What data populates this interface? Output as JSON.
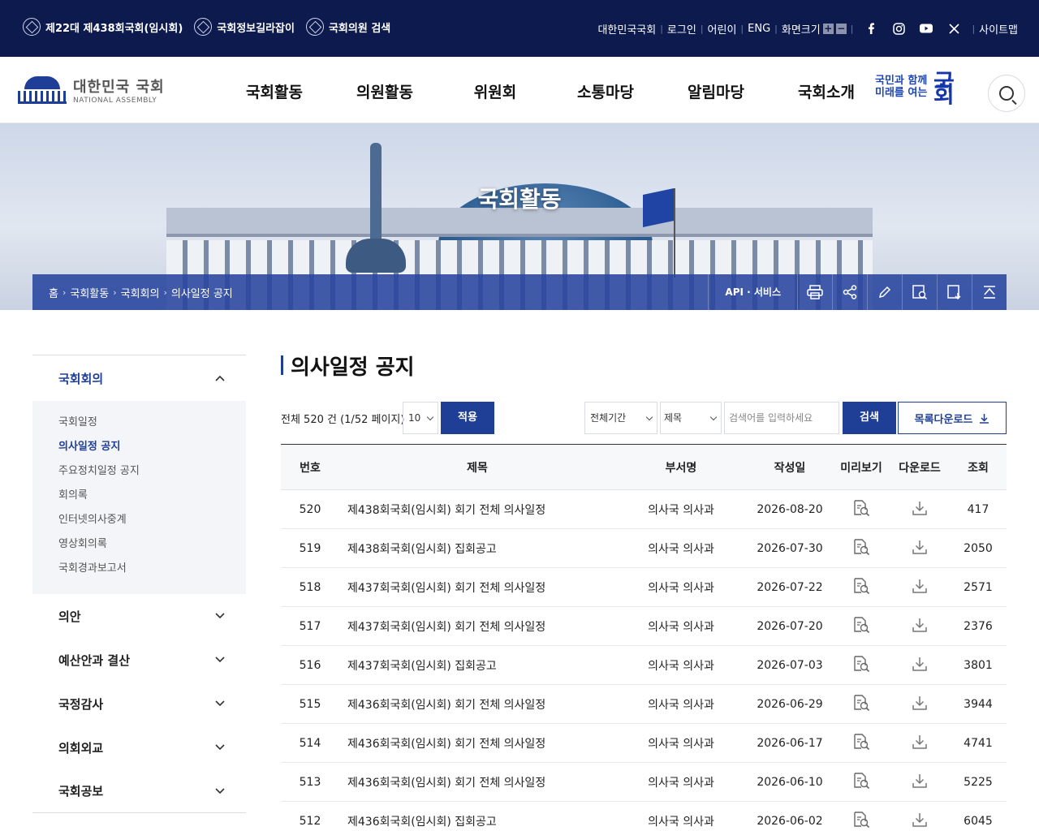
{
  "topbar": {
    "quick_links": [
      "제22대 제438회국회(임시회)",
      "국회정보길라잡이",
      "국회의원 검색"
    ],
    "util_links": [
      "대한민국국회",
      "로그인",
      "어린이",
      "ENG"
    ],
    "font_size_label": "화면크기",
    "font_plus": "+",
    "font_minus": "−",
    "social_icons": [
      "facebook-icon",
      "instagram-icon",
      "youtube-icon",
      "x-icon"
    ],
    "sitemap": "사이트맵"
  },
  "header": {
    "logo_kr": "대한민국 국회",
    "logo_en": "NATIONAL ASSEMBLY",
    "menu": [
      "국회활동",
      "의원활동",
      "위원회",
      "소통마당",
      "알림마당",
      "국회소개"
    ],
    "slogan_line1": "국민과 함께",
    "slogan_line2": "미래를 여는",
    "slogan_big": "국회"
  },
  "hero": {
    "title": "국회활동",
    "breadcrumb": [
      "홈",
      "국회활동",
      "국회회의",
      "의사일정 공지"
    ],
    "api_label": "API · 서비스",
    "tool_icons": [
      "print-icon",
      "share-icon",
      "edit-icon",
      "search-doc-icon",
      "download-doc-icon",
      "top-icon"
    ]
  },
  "sidebar": {
    "open_section": "국회회의",
    "sub_items": [
      {
        "label": "국회일정",
        "active": false
      },
      {
        "label": "의사일정 공지",
        "active": true
      },
      {
        "label": "주요정치일정 공지",
        "active": false
      },
      {
        "label": "회의록",
        "active": false
      },
      {
        "label": "인터넷의사중계",
        "active": false
      },
      {
        "label": "영상회의록",
        "active": false
      },
      {
        "label": "국회경과보고서",
        "active": false
      }
    ],
    "sections": [
      "의안",
      "예산안과 결산",
      "국정감사",
      "의회외교",
      "국회공보"
    ]
  },
  "main": {
    "title": "의사일정 공지",
    "total_text": "전체 520 건 (1/52 페이지)",
    "page_size": "10",
    "apply_label": "적용",
    "period_select": "전체기간",
    "field_select": "제목",
    "search_placeholder": "검색어를 입력하세요",
    "search_label": "검색",
    "download_list_label": "목록다운로드",
    "columns": [
      "번호",
      "제목",
      "부서명",
      "작성일",
      "미리보기",
      "다운로드",
      "조회"
    ],
    "rows": [
      {
        "no": "520",
        "title": "제438회국회(임시회) 회기 전체 의사일정",
        "dept": "의사국 의사과",
        "date": "2026-08-20",
        "views": "417"
      },
      {
        "no": "519",
        "title": "제438회국회(임시회) 집회공고",
        "dept": "의사국 의사과",
        "date": "2026-07-30",
        "views": "2050"
      },
      {
        "no": "518",
        "title": "제437회국회(임시회) 회기 전체 의사일정",
        "dept": "의사국 의사과",
        "date": "2026-07-22",
        "views": "2571"
      },
      {
        "no": "517",
        "title": "제437회국회(임시회) 회기 전체 의사일정",
        "dept": "의사국 의사과",
        "date": "2026-07-20",
        "views": "2376"
      },
      {
        "no": "516",
        "title": "제437회국회(임시회) 집회공고",
        "dept": "의사국 의사과",
        "date": "2026-07-03",
        "views": "3801"
      },
      {
        "no": "515",
        "title": "제436회국회(임시회) 회기 전체 의사일정",
        "dept": "의사국 의사과",
        "date": "2026-06-29",
        "views": "3944"
      },
      {
        "no": "514",
        "title": "제436회국회(임시회) 회기 전체 의사일정",
        "dept": "의사국 의사과",
        "date": "2026-06-17",
        "views": "4741"
      },
      {
        "no": "513",
        "title": "제436회국회(임시회) 회기 전체 의사일정",
        "dept": "의사국 의사과",
        "date": "2026-06-10",
        "views": "5225"
      },
      {
        "no": "512",
        "title": "제436회국회(임시회) 집회공고",
        "dept": "의사국 의사과",
        "date": "2026-06-02",
        "views": "6045"
      }
    ]
  },
  "colors": {
    "navy": "#0c1a4e",
    "primary": "#1f3f97",
    "locbar": "#28449e"
  }
}
